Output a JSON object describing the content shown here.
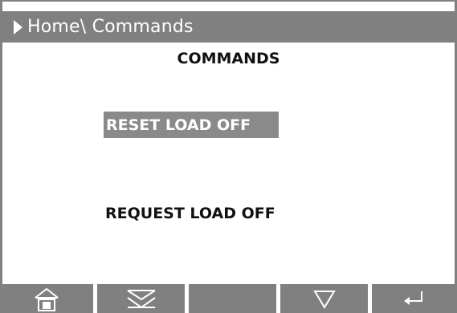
{
  "header": {
    "breadcrumb": "Home\\ Commands"
  },
  "page": {
    "title": "COMMANDS"
  },
  "commands": {
    "reset_load_off": "RESET LOAD OFF",
    "request_load_off": "REQUEST LOAD OFF"
  },
  "softkeys": [
    {
      "icon": "home-icon"
    },
    {
      "icon": "double-chevron-down-icon"
    },
    {
      "icon": "blank"
    },
    {
      "icon": "triangle-down-icon"
    },
    {
      "icon": "enter-icon"
    }
  ],
  "colors": {
    "bar": "#808080",
    "selected": "#8a8a8a",
    "text": "#111111",
    "background": "#ffffff"
  }
}
